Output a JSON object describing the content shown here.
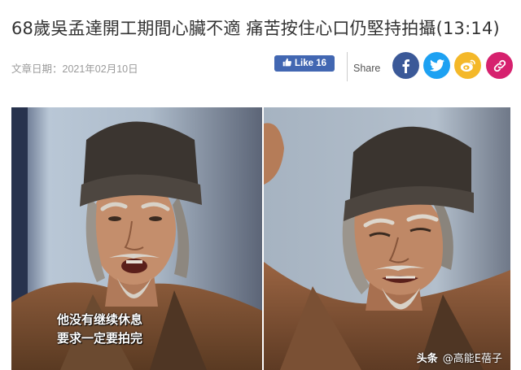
{
  "article": {
    "title": "68歲吳孟達開工期間心臟不適 痛苦按住心口仍堅持拍攝(13:14)",
    "date": "文章日期：2021年02月10日"
  },
  "social": {
    "like_label": "Like 16",
    "share_label": "Share",
    "buttons": [
      "facebook-icon",
      "twitter-icon",
      "weibo-icon",
      "link-icon"
    ],
    "colors": {
      "facebook": "#3b5998",
      "twitter": "#1da1f2",
      "weibo": "#f4b829",
      "link": "#d6216e",
      "like": "#4267b2"
    }
  },
  "images": {
    "left_caption_line1": "他没有继续休息",
    "left_caption_line2": "要求一定要拍完",
    "watermark_brand": "头条",
    "watermark_author": "@高能E蓓子"
  }
}
